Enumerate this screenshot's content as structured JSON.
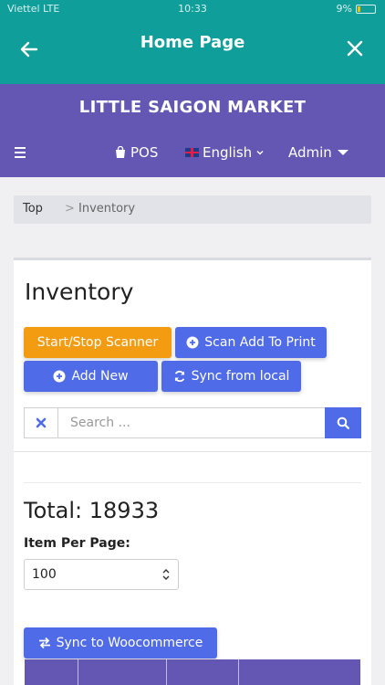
{
  "status_bar": {
    "carrier": "Viettel  LTE",
    "time": "10:33",
    "battery": "9%"
  },
  "top_bar": {
    "title": "Home Page",
    "back_icon": "arrow-left-icon",
    "close_icon": "close-icon"
  },
  "nav": {
    "store_name": "LITTLE SAIGON MARKET",
    "pos_label": "POS",
    "language_label": "English",
    "admin_label": "Admin"
  },
  "breadcrumb": {
    "top": "Top",
    "separator": ">",
    "current": "Inventory"
  },
  "inventory": {
    "title": "Inventory",
    "buttons": {
      "start_stop_scanner": "Start/Stop Scanner",
      "scan_add_to_print": "Scan Add To Print",
      "add_new": "Add New",
      "sync_from_local": "Sync from local",
      "sync_to_woocommerce": "Sync to Woocommerce"
    },
    "search": {
      "placeholder": "Search ...",
      "value": ""
    },
    "total": "Total: 18933",
    "items_per_page_label": "Item Per Page:",
    "items_per_page_value": "100"
  },
  "colors": {
    "header_teal": "#0f9e9a",
    "nav_purple": "#6457b3",
    "primary_blue": "#4f6be8",
    "orange": "#f39c12"
  }
}
